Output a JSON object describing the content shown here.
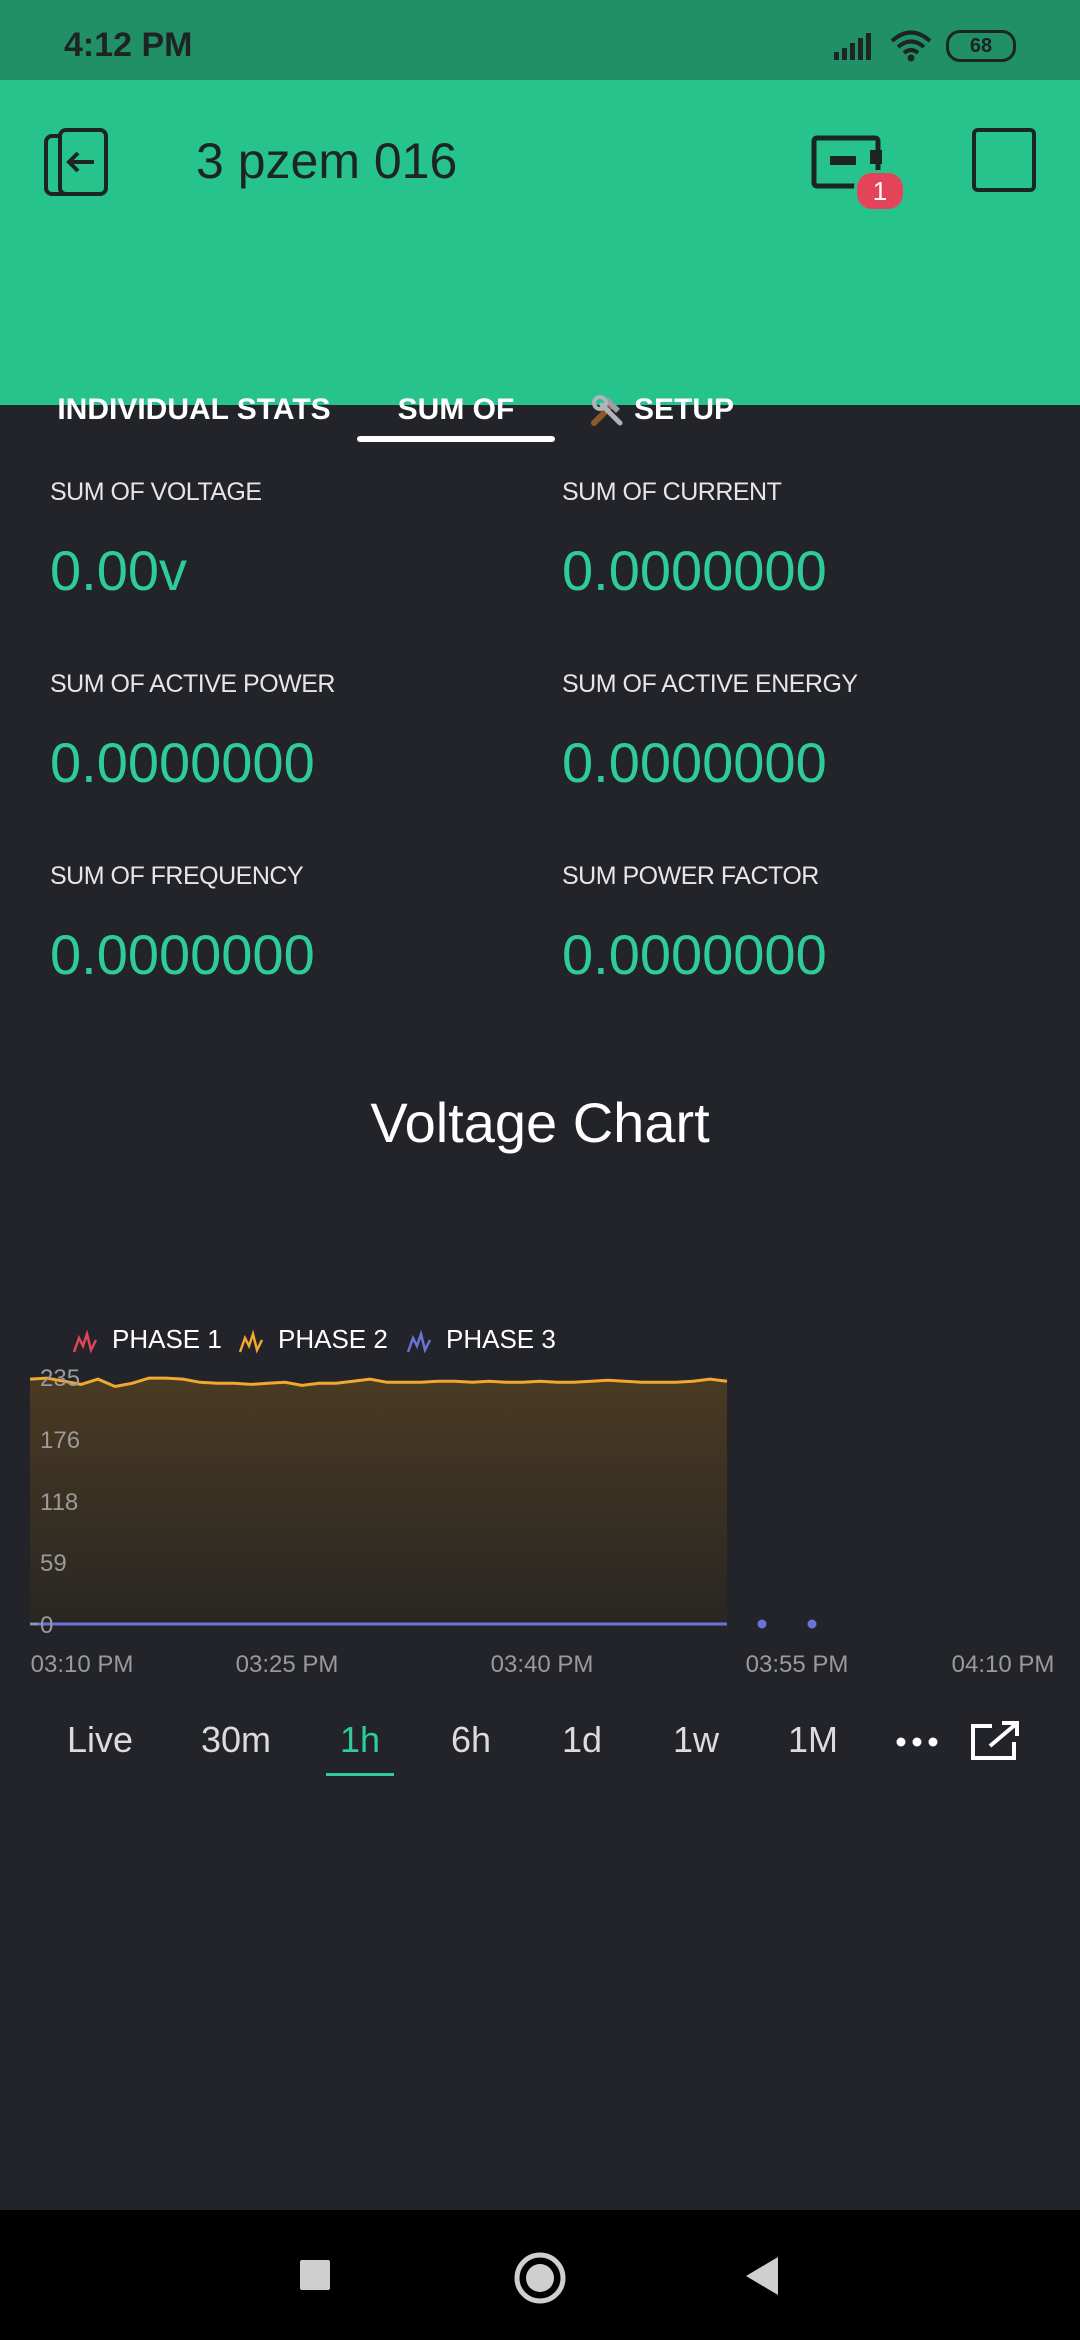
{
  "status_bar": {
    "time": "4:12 PM",
    "battery": "68"
  },
  "header": {
    "title": "3 pzem 016",
    "device_badge": "1",
    "tabs": [
      {
        "label": "INDIVIDUAL STATS"
      },
      {
        "label": "SUM OF"
      },
      {
        "label": "SETUP",
        "icon": "tools-icon"
      }
    ],
    "active_tab": "SUM OF"
  },
  "stats": {
    "voltage": {
      "label": "SUM OF VOLTAGE",
      "value": "0.00v"
    },
    "current": {
      "label": "SUM OF CURRENT",
      "value": "0.0000000"
    },
    "active_power": {
      "label": "SUM OF ACTIVE POWER",
      "value": "0.0000000"
    },
    "active_energy": {
      "label": "SUM OF ACTIVE ENERGY",
      "value": "0.0000000"
    },
    "frequency": {
      "label": "SUM OF FREQUENCY",
      "value": "0.0000000"
    },
    "power_factor": {
      "label": "SUM POWER FACTOR",
      "value": "0.0000000"
    }
  },
  "chart_data": {
    "type": "line",
    "title": "Voltage Chart",
    "series": [
      {
        "name": "PHASE 1",
        "color": "#e3445a",
        "values": [
          0,
          0,
          0,
          0,
          0,
          0,
          0,
          0,
          0,
          0,
          0,
          0,
          0,
          0,
          0,
          0,
          0,
          0,
          0,
          0,
          0,
          0,
          0,
          0,
          0,
          0,
          0,
          0,
          0,
          0,
          0,
          0,
          0,
          0,
          0,
          0,
          0,
          0,
          0,
          0,
          0,
          0
        ]
      },
      {
        "name": "PHASE 2",
        "color": "#f0a830",
        "values": [
          233,
          234,
          231,
          228,
          233,
          226,
          229,
          234,
          234,
          233,
          230,
          229,
          229,
          228,
          229,
          230,
          227,
          229,
          229,
          231,
          233,
          230,
          230,
          230,
          231,
          231,
          230,
          231,
          230,
          230,
          231,
          230,
          230,
          231,
          232,
          231,
          230,
          230,
          230,
          231,
          233,
          231
        ]
      },
      {
        "name": "PHASE 3",
        "color": "#6b73d9",
        "values": [
          0,
          0,
          0,
          0,
          0,
          0,
          0,
          0,
          0,
          0,
          0,
          0,
          0,
          0,
          0,
          0,
          0,
          0,
          0,
          0,
          0,
          0,
          0,
          0,
          0,
          0,
          0,
          0,
          0,
          0,
          0,
          0,
          0,
          0,
          0,
          0,
          0,
          0,
          0,
          0,
          0,
          0
        ]
      }
    ],
    "x_range": [
      "03:10 PM",
      "03:51 PM"
    ],
    "x_ticks": [
      "03:10 PM",
      "03:25 PM",
      "03:40 PM",
      "03:55 PM",
      "04:10 PM"
    ],
    "y_ticks": [
      "235",
      "176",
      "118",
      "59",
      "0"
    ],
    "ylim": [
      0,
      235
    ],
    "legend_position": "top-left",
    "grid": false
  },
  "time_ranges": [
    "Live",
    "30m",
    "1h",
    "6h",
    "1d",
    "1w",
    "1M"
  ],
  "selected_range": "1h"
}
